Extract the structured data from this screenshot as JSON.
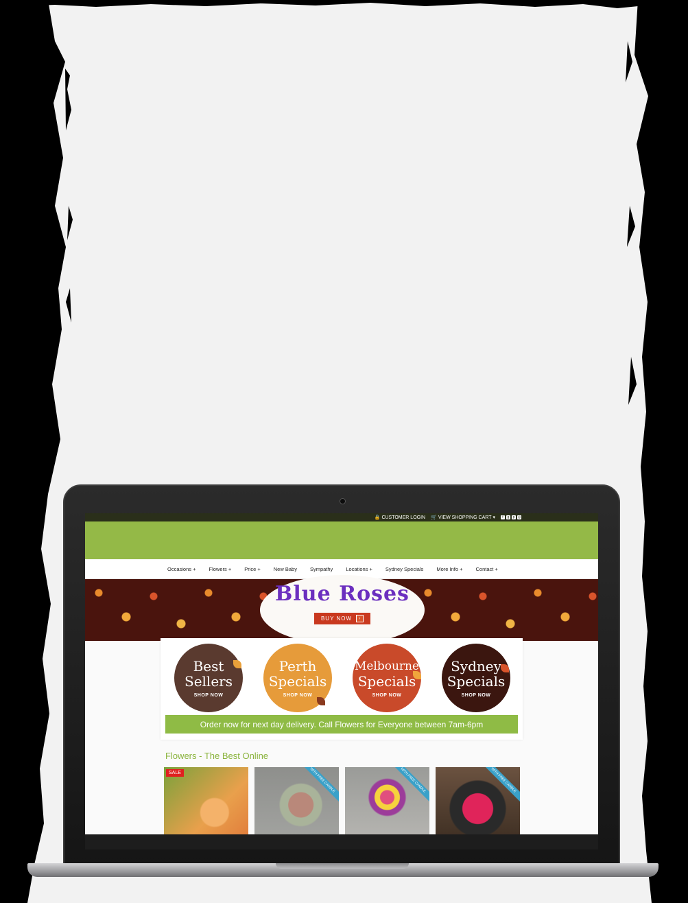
{
  "topbar": {
    "customer_login": "CUSTOMER LOGIN",
    "view_cart": "VIEW SHOPPING CART",
    "social_icons": [
      "facebook-icon",
      "google-plus-icon",
      "pinterest-icon",
      "instagram-icon"
    ]
  },
  "nav": {
    "items": [
      "Occasions +",
      "Flowers +",
      "Price +",
      "New Baby",
      "Sympathy",
      "Locations +",
      "Sydney Specials",
      "More Info +",
      "Contact +"
    ]
  },
  "hero": {
    "title": "Blue Roses",
    "button": "BUY NOW"
  },
  "promos": [
    {
      "line1": "Best",
      "line2": "Sellers",
      "cta": "SHOP NOW"
    },
    {
      "line1": "Perth",
      "line2": "Specials",
      "cta": "SHOP NOW"
    },
    {
      "line1": "Melbourne",
      "line2": "Specials",
      "cta": "SHOP NOW"
    },
    {
      "line1": "Sydney",
      "line2": "Specials",
      "cta": "SHOP NOW"
    }
  ],
  "delivery_text": "Order now for next day delivery. Call Flowers for Everyone between 7am-6pm",
  "section_title": "Flowers - The Best Online",
  "products": [
    {
      "badge": "SALE",
      "ribbon": ""
    },
    {
      "badge": "",
      "ribbon": "WITH FREE CANDLE"
    },
    {
      "badge": "",
      "ribbon": "WITH FREE CANDLE"
    },
    {
      "badge": "",
      "ribbon": "WITH FREE CANDLE"
    }
  ],
  "colors": {
    "header_green": "#94b947",
    "topbar_dark": "#2a2f1a",
    "hero_title_purple": "#6b2fbf",
    "buy_button_red": "#c9391f",
    "section_title_green": "#8ab33c"
  }
}
